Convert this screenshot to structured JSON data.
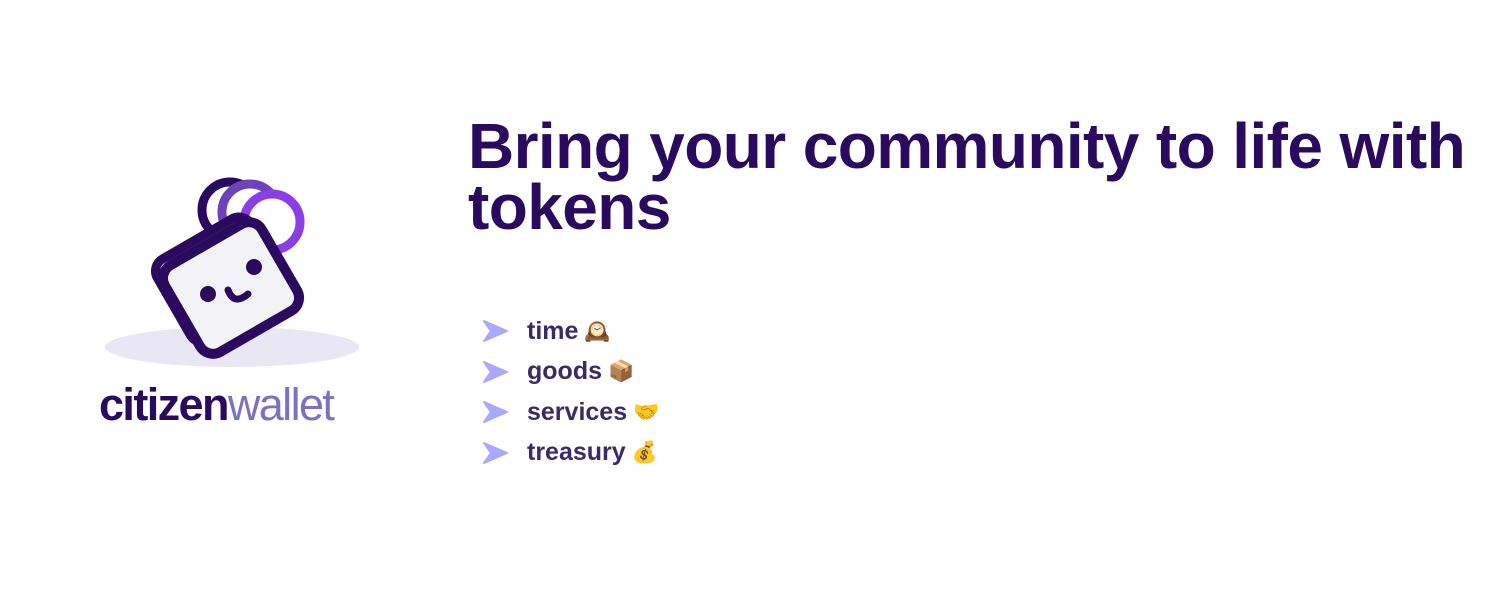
{
  "logo": {
    "wordmark_bold": "citizen",
    "wordmark_light": "wallet",
    "colors": {
      "dark": "#2a0a5e",
      "light_text": "#7a72c0",
      "coin_accent": "#8a3fe6",
      "shadow": "#e9e7f3"
    }
  },
  "headline": "Bring your community to life with tokens",
  "features": [
    {
      "label": "time",
      "emoji": "🕰️"
    },
    {
      "label": "goods",
      "emoji": "📦"
    },
    {
      "label": "services",
      "emoji": "🤝"
    },
    {
      "label": "treasury",
      "emoji": "💰"
    }
  ],
  "colors": {
    "arrow": "#a8a8ff",
    "headline": "#2a0a5e",
    "feature_text": "#3a2a68"
  }
}
